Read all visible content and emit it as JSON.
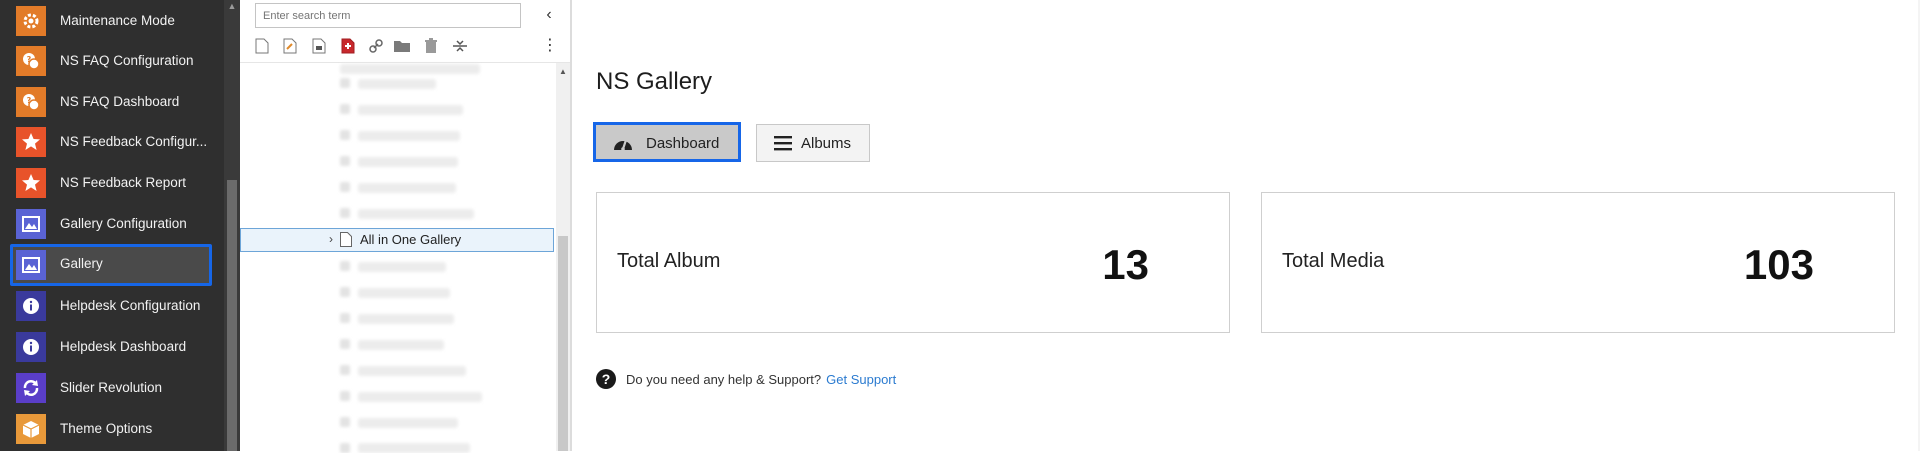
{
  "sidebar": {
    "items": [
      {
        "label": "Maintenance Mode",
        "icon": "gear-icon",
        "color": "#e27b29"
      },
      {
        "label": "NS FAQ Configuration",
        "icon": "faq-icon",
        "color": "#e27b29"
      },
      {
        "label": "NS FAQ Dashboard",
        "icon": "faq-icon",
        "color": "#e27b29"
      },
      {
        "label": "NS Feedback Configur...",
        "icon": "star-icon",
        "color": "#e8532a"
      },
      {
        "label": "NS Feedback Report",
        "icon": "star-icon",
        "color": "#e8532a"
      },
      {
        "label": "Gallery Configuration",
        "icon": "image-icon",
        "color": "#5a63d4"
      },
      {
        "label": "Gallery",
        "icon": "image-icon",
        "color": "#5a63d4",
        "active": true
      },
      {
        "label": "Helpdesk Configuration",
        "icon": "info-icon",
        "color": "#3a3a9c"
      },
      {
        "label": "Helpdesk Dashboard",
        "icon": "info-icon",
        "color": "#3a3a9c"
      },
      {
        "label": "Slider Revolution",
        "icon": "refresh-icon",
        "color": "#5a3ec8"
      },
      {
        "label": "Theme Options",
        "icon": "box-icon",
        "color": "#e8993a"
      }
    ]
  },
  "tree": {
    "search_placeholder": "Enter search term",
    "selected_page": "All in One Gallery"
  },
  "main": {
    "title": "NS Gallery",
    "tabs": {
      "dashboard": "Dashboard",
      "albums": "Albums"
    },
    "cards": [
      {
        "label": "Total Album",
        "value": "13"
      },
      {
        "label": "Total Media",
        "value": "103"
      }
    ],
    "help": {
      "text": "Do you need any help & Support?",
      "link": "Get Support"
    }
  },
  "colors": {
    "accent": "#1666e8",
    "link": "#2b7bd0",
    "sidebar_bg": "#2f2f2f"
  }
}
